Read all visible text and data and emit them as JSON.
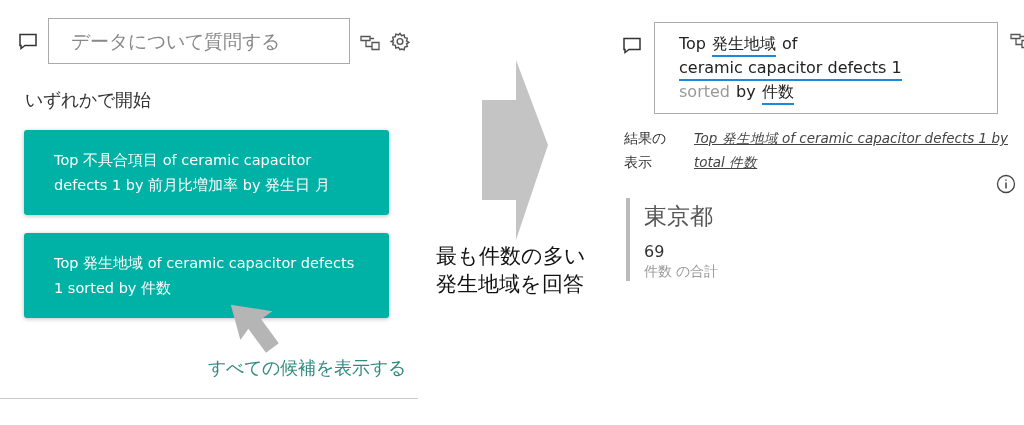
{
  "left_panel": {
    "question_field": {
      "placeholder": "データについて質問する"
    },
    "start_heading": "いずれかで開始",
    "suggestions": [
      "Top 不具合項目 of ceramic capacitor defects 1 by 前月比増加率 by 発生日 月",
      "Top 発生地域 of ceramic capacitor defects 1 sorted by 件数"
    ],
    "show_all_link": "すべての候補を表示する"
  },
  "annotation": {
    "caption": "最も件数の多い発生地域を回答"
  },
  "right_panel": {
    "query_lines": [
      [
        {
          "text": "Top",
          "underlined": false,
          "faded": false
        },
        {
          "text": "発生地域",
          "underlined": true,
          "faded": false
        },
        {
          "text": "of",
          "underlined": false,
          "faded": false
        }
      ],
      [
        {
          "text": "ceramic capacitor defects 1",
          "underlined": true,
          "faded": false
        }
      ],
      [
        {
          "text": "sorted",
          "underlined": false,
          "faded": true
        },
        {
          "text": "by",
          "underlined": false,
          "faded": false
        },
        {
          "text": "件数",
          "underlined": true,
          "faded": false
        }
      ]
    ],
    "result_label": "結果の表示",
    "result_link": "Top 発生地域 of ceramic capacitor defects 1 by total 件数",
    "card": {
      "title": "東京都",
      "value": "69",
      "caption": "件数 の合計"
    }
  }
}
